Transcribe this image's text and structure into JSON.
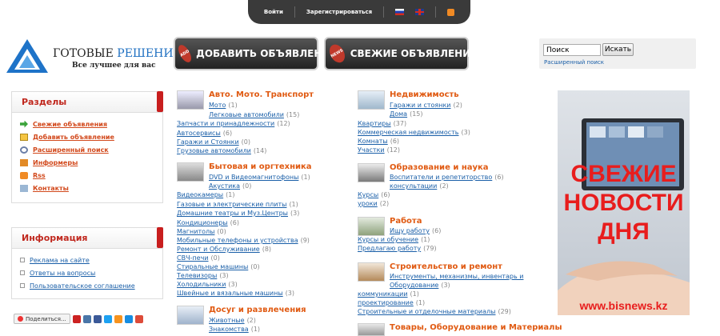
{
  "topbar": {
    "login": "Войти",
    "register": "Зарегистрироваться"
  },
  "logo": {
    "title_part1": "ГОТОВЫЕ ",
    "title_part2": "РЕШЕНИЯ",
    "subtitle": "Все лучшее для вас"
  },
  "header_buttons": {
    "add": "ДОБАВИТЬ ОБЪЯВЛЕНИЯ",
    "news": "СВЕЖИЕ ОБЪЯВЛЕНИЯ",
    "add_tag": "ADD",
    "news_tag": "NEWS"
  },
  "search": {
    "value": "Поиск",
    "button": "Искать",
    "advanced": "Расширенный поиск"
  },
  "sections": {
    "title": "Разделы",
    "items": [
      "Свежие объявления",
      "Добавить объявление",
      "Расширенный поиск",
      "Информеры",
      "Rss",
      "Контакты"
    ]
  },
  "info": {
    "title": "Информация",
    "items": [
      "Реклама на сайте",
      "Ответы на вопросы",
      "Пользовательское соглашение"
    ]
  },
  "share": {
    "label": "Поделиться..."
  },
  "categories": {
    "auto": {
      "title": "Авто. Мото. Транспорт",
      "subs": [
        {
          "name": "Мото",
          "count": "(1)"
        },
        {
          "name": "Легковые автомобили",
          "count": "(15)"
        },
        {
          "name": "Запчасти и принадлежности",
          "count": "(12)"
        },
        {
          "name": "Автосервисы",
          "count": "(6)"
        },
        {
          "name": "Гаражи и Стоянки",
          "count": "(0)"
        },
        {
          "name": "Грузовые автомобили",
          "count": "(14)"
        }
      ]
    },
    "tech": {
      "title": "Бытовая и оргтехника",
      "subs": [
        {
          "name": "DVD и Видеомагнитофоны",
          "count": "(1)"
        },
        {
          "name": "Акустика",
          "count": "(0)"
        },
        {
          "name": "Видеокамеры",
          "count": "(1)"
        },
        {
          "name": "Газовые и электрические плиты",
          "count": "(1)"
        },
        {
          "name": "Домашние театры и Муз.Центры",
          "count": "(3)"
        },
        {
          "name": "Кондиционеры",
          "count": "(6)"
        },
        {
          "name": "Магнитолы",
          "count": "(0)"
        },
        {
          "name": "Мобильные телефоны и устройства",
          "count": "(9)"
        },
        {
          "name": "Ремонт и Обслуживание",
          "count": "(8)"
        },
        {
          "name": "СВЧ-печи",
          "count": "(0)"
        },
        {
          "name": "Стиральные машины",
          "count": "(0)"
        },
        {
          "name": "Телевизоры",
          "count": "(3)"
        },
        {
          "name": "Холодильники",
          "count": "(3)"
        },
        {
          "name": "Швейные и вязальные машины",
          "count": "(3)"
        }
      ]
    },
    "leisure": {
      "title": "Досуг и развлечения",
      "subs": [
        {
          "name": "Животные",
          "count": "(2)"
        },
        {
          "name": "Знакомства",
          "count": "(1)"
        }
      ]
    },
    "realty": {
      "title": "Недвижимость",
      "subs": [
        {
          "name": "Гаражи и стоянки",
          "count": "(2)"
        },
        {
          "name": "Дома",
          "count": "(15)"
        },
        {
          "name": "Квартиры",
          "count": "(37)"
        },
        {
          "name": "Коммерческая недвижимость",
          "count": "(3)"
        },
        {
          "name": "Комнаты",
          "count": "(6)"
        },
        {
          "name": "Участки",
          "count": "(12)"
        }
      ]
    },
    "education": {
      "title": "Образование и наука",
      "subs": [
        {
          "name": "Воспитатели и репетиторство",
          "count": "(6)"
        },
        {
          "name": "консультации",
          "count": "(2)"
        },
        {
          "name": "Курсы",
          "count": "(6)"
        },
        {
          "name": "уроки",
          "count": "(2)"
        }
      ]
    },
    "work": {
      "title": "Работа",
      "subs": [
        {
          "name": "Ищу работу",
          "count": "(6)"
        },
        {
          "name": "Курсы и обучение",
          "count": "(1)"
        },
        {
          "name": "Предлагаю работу",
          "count": "(79)"
        }
      ]
    },
    "build": {
      "title": "Строительство и ремонт",
      "subs": [
        {
          "name": "Инструменты, механизмы, инвентарь и",
          "count": ""
        },
        {
          "name": "Оборудование",
          "count": "(3)"
        },
        {
          "name": "коммуникации",
          "count": "(1)"
        },
        {
          "name": "проектирование",
          "count": "(1)"
        },
        {
          "name": "Строительные и отделочные материалы",
          "count": "(29)"
        }
      ]
    },
    "goods": {
      "title": "Товары, Оборудование и Материалы"
    }
  },
  "banner": {
    "line1": "СВЕЖИЕ",
    "line2": "НОВОСТИ",
    "line3": "ДНЯ",
    "url": "www.bisnews.kz"
  },
  "colors": {
    "accent_orange": "#e05a12",
    "link_blue": "#1a5fa8",
    "section_red": "#c0281e",
    "banner_red": "#e81d1d"
  }
}
